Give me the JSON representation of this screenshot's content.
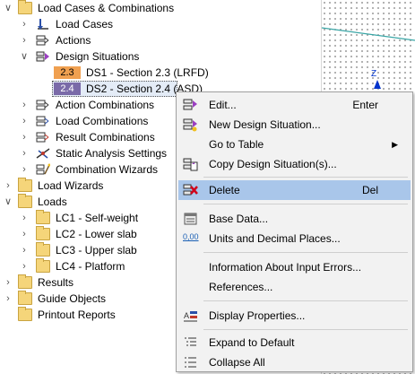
{
  "tree": {
    "root_label": "Load Cases & Combinations",
    "load_cases": "Load Cases",
    "actions": "Actions",
    "design_situations": "Design Situations",
    "ds1": {
      "badge": "2.3",
      "label": "DS1 - Section 2.3 (LRFD)",
      "color": "#f0a050"
    },
    "ds2": {
      "badge": "2.4",
      "label": "DS2 - Section 2.4 (ASD)",
      "color": "#7a6aa8"
    },
    "action_combinations": "Action Combinations",
    "load_combinations": "Load Combinations",
    "result_combinations": "Result Combinations",
    "static_analysis_settings": "Static Analysis Settings",
    "combination_wizards": "Combination Wizards",
    "load_wizards": "Load Wizards",
    "loads": "Loads",
    "lc1": "LC1 - Self-weight",
    "lc2": "LC2 - Lower slab",
    "lc3": "LC3 - Upper slab",
    "lc4": "LC4 - Platform",
    "results": "Results",
    "guide_objects": "Guide Objects",
    "printout_reports": "Printout Reports"
  },
  "viewport": {
    "axis_label": "Z"
  },
  "context_menu": {
    "edit": "Edit...",
    "edit_shortcut": "Enter",
    "new_ds": "New Design Situation...",
    "go_to_table": "Go to Table",
    "copy_ds": "Copy Design Situation(s)...",
    "delete": "Delete",
    "delete_shortcut": "Del",
    "base_data": "Base Data...",
    "units": "Units and Decimal Places...",
    "units_icon_text": "0,00",
    "info_errors": "Information About Input Errors...",
    "references": "References...",
    "display_properties": "Display Properties...",
    "expand_default": "Expand to Default",
    "collapse_all": "Collapse All"
  },
  "colors": {
    "highlight": "#a9c6ea",
    "folder": "#f5d57a",
    "accent": "#0033cc"
  }
}
